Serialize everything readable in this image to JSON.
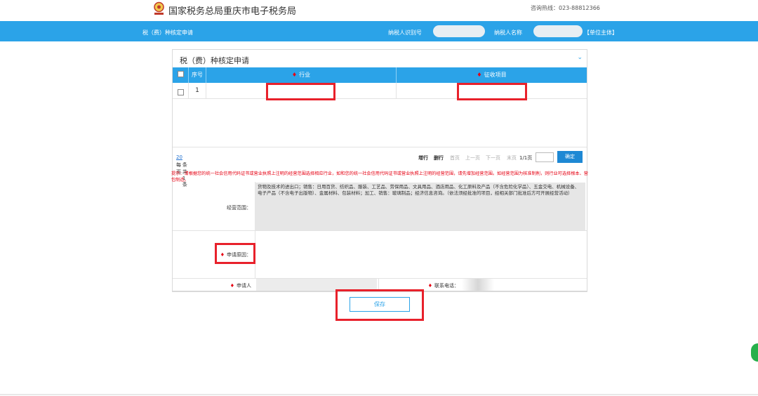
{
  "header": {
    "site_title": "国家税务总局重庆市电子税务局",
    "hotline": "咨询热线：023-88812366"
  },
  "bluebar": {
    "page_name": "税（费）种核定申请",
    "taxpayer_id_label": "纳税人识别号",
    "taxpayer_name_label": "纳税人名称",
    "entity_type": "【单位主体】"
  },
  "panel": {
    "title": "税（费）种核定申请",
    "columns": [
      "序号",
      "行业",
      "征收项目"
    ],
    "rows": [
      {
        "index": "1",
        "industry": "",
        "item": ""
      }
    ]
  },
  "pager": {
    "per_page_prefix": "每页",
    "per_page_value": "20",
    "per_page_suffix": "条 共1条",
    "add_row": "增行",
    "delete_row": "删行",
    "first": "首页",
    "prev": "上一页",
    "next": "下一页",
    "last": "末页",
    "page_info": "1/1页",
    "confirm": "确定"
  },
  "notice": "提示：请根据您的统一社会信用代码证书或营业执照上注明的经营范围选择相应行业，如和您的统一社会信用代码证书或营业执照上注明的经营范围，请先增加经营范围。如经营范围为核准制削，则行业可选择根本、营包制造。",
  "form": {
    "scope_label": "经营范围：",
    "scope_text": "货物及技术的进出口；销售：日用百货、纺织品、服装、工艺品、劳保用品、文具用品、酒店用品、化工原料及产品（不含危险化学品）、五金交电、机械设备、电子产品（不含电子出版物）、金属材料、包装材料；加工、销售：玻璃制品；经济信息咨询。（依法须经批准的项目，经相关部门批准后方可开展经营活动）",
    "reason_label": "申请原因：",
    "applicant_label": "申请人",
    "phone_label": "联系电话："
  },
  "save_button": "保存",
  "colors": {
    "accent": "#2ba3e8",
    "highlight": "#e8212b",
    "required": "#e60012"
  }
}
